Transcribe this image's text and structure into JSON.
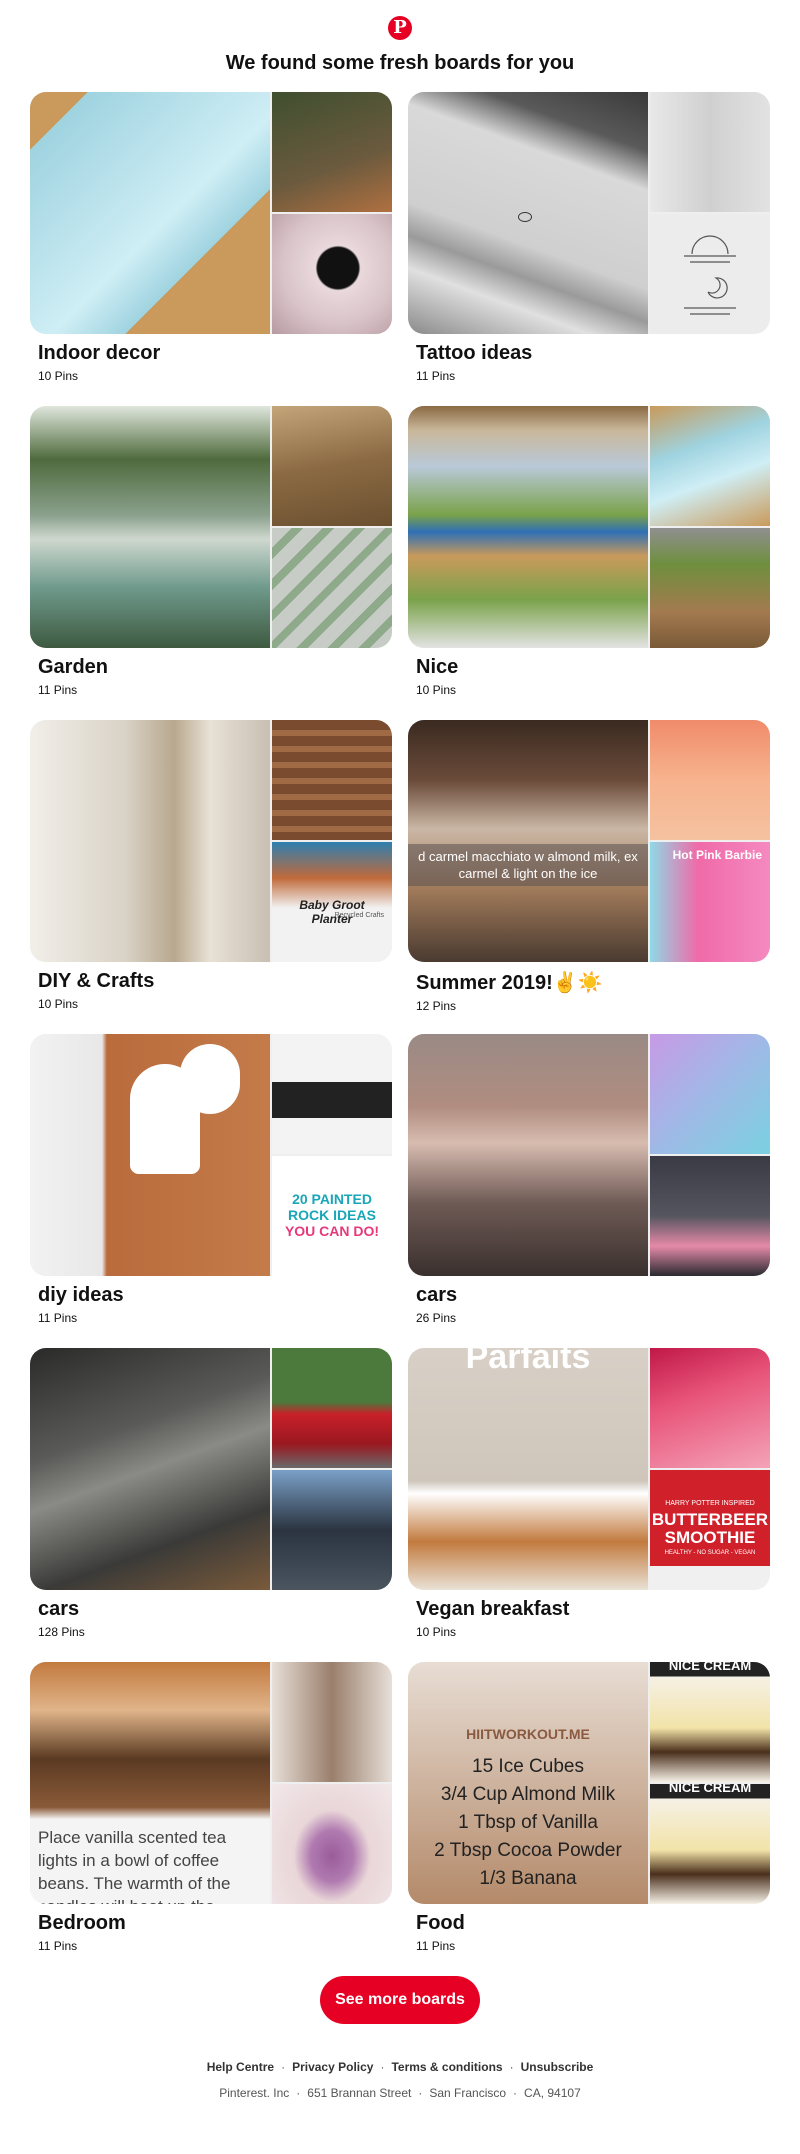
{
  "header": {
    "logo_letter": "P",
    "headline": "We found some fresh boards for you"
  },
  "boards": [
    {
      "title": "Indoor decor",
      "pins": "10 Pins",
      "tiles": {
        "main": {
          "desc": "wooden indoor plunge pool",
          "colors": [
            "#c99a5b",
            "#9fd3e0"
          ]
        },
        "top": {
          "desc": "plants on shelves",
          "colors": [
            "#6b5a3e",
            "#3f4f2f"
          ]
        },
        "bottom": {
          "desc": "white tyre planter",
          "colors": [
            "#e9d8dc",
            "#b79aa2"
          ]
        }
      }
    },
    {
      "title": "Tattoo ideas",
      "pins": "11 Pins",
      "tiles": {
        "main": {
          "desc": "small planet tattoo on shoulder",
          "colors": [
            "#d9d9d9",
            "#8a8a8a"
          ]
        },
        "top": {
          "desc": "finger tattoos",
          "colors": [
            "#e2e2e2",
            "#bdbdbd"
          ]
        },
        "bottom": {
          "desc": "sun and moon tattoo sketch",
          "colors": [
            "#ececec",
            "#cfcfcf"
          ]
        }
      }
    },
    {
      "title": "Garden",
      "pins": "11 Pins",
      "tiles": {
        "main": {
          "desc": "bathtub pond with plants",
          "colors": [
            "#8aa08c",
            "#3e5a40"
          ]
        },
        "top": {
          "desc": "wooden pallet planters",
          "colors": [
            "#8b6a43",
            "#c4a57a"
          ]
        },
        "bottom": {
          "desc": "succulents in concrete blocks",
          "colors": [
            "#c8ccc7",
            "#8fa98b"
          ]
        }
      }
    },
    {
      "title": "Nice",
      "pins": "10 Pins",
      "tiles": {
        "main": {
          "desc": "above ground pool with wooden deck",
          "colors": [
            "#7aa24a",
            "#c99a5b"
          ]
        },
        "top": {
          "desc": "wooden pool frame",
          "colors": [
            "#9fd3e0",
            "#c99a5b"
          ]
        },
        "bottom": {
          "desc": "garden steps",
          "colors": [
            "#6f8f3e",
            "#a37a4f"
          ]
        }
      }
    },
    {
      "title": "DIY & Crafts",
      "pins": "10 Pins",
      "tiles": {
        "main": {
          "desc": "rustic door shelf with flowers",
          "colors": [
            "#e8e1d6",
            "#b8a88e"
          ]
        },
        "top": {
          "desc": "pallet bench",
          "colors": [
            "#7a4b2e",
            "#a06a45"
          ]
        },
        "bottom": {
          "desc": "Baby Groot planter",
          "colors": [
            "#f2f2f2",
            "#7b6a4a"
          ]
        },
        "bottom_caption": "Baby Groot Planter",
        "bottom_subcaption": "Recycled Crafts"
      }
    },
    {
      "title": "Summer 2019!✌️☀️",
      "pins": "12 Pins",
      "tiles": {
        "main": {
          "desc": "iced caramel macchiato",
          "colors": [
            "#6b4b3a",
            "#cbb7a5"
          ]
        },
        "main_caption": "d carmel macchiato w almond milk, ex carmel & light on the ice",
        "top": {
          "desc": "peach drink recipe",
          "colors": [
            "#f7b38e",
            "#f08b6a"
          ]
        },
        "bottom": {
          "desc": "pink cocktail",
          "colors": [
            "#f06aa8",
            "#8fd9e6"
          ]
        },
        "bottom_caption": "Hot Pink Barbie"
      }
    },
    {
      "title": "diy ideas",
      "pins": "11 Pins",
      "tiles": {
        "main": {
          "desc": "paper craft tutorial",
          "colors": [
            "#b96b3c",
            "#ffffff"
          ]
        },
        "top": {
          "desc": "black card",
          "colors": [
            "#f3f3f3",
            "#222222"
          ]
        },
        "bottom": {
          "desc": "painted rocks",
          "colors": [
            "#ffffff",
            "#1aa6b7"
          ]
        },
        "bottom_caption_1": "20 PAINTED",
        "bottom_caption_2": "ROCK IDEAS",
        "bottom_caption_3": "YOU CAN DO!"
      }
    },
    {
      "title": "cars",
      "pins": "26 Pins",
      "tiles": {
        "main": {
          "desc": "rose gold Lamborghini",
          "colors": [
            "#b08d80",
            "#6e5a55"
          ]
        },
        "top": {
          "desc": "holographic Lamborghini",
          "colors": [
            "#9fb9e6",
            "#c79ae6"
          ]
        },
        "bottom": {
          "desc": "pink sports car",
          "colors": [
            "#3a3a45",
            "#e58aa8"
          ]
        }
      }
    },
    {
      "title": "cars",
      "pins": "128 Pins",
      "tiles": {
        "main": {
          "desc": "grey Lamborghini Huracan",
          "colors": [
            "#5a5a58",
            "#2a2a28"
          ]
        },
        "top": {
          "desc": "red Ferrari",
          "colors": [
            "#4b7a3c",
            "#c8202a"
          ]
        },
        "bottom": {
          "desc": "dark sports car",
          "colors": [
            "#7aa0c8",
            "#2b3440"
          ]
        }
      }
    },
    {
      "title": "Vegan breakfast",
      "pins": "10 Pins",
      "tiles": {
        "main": {
          "desc": "chia parfaits and granola",
          "colors": [
            "#d8d0c6",
            "#c27a3e"
          ]
        },
        "main_caption": "Parfaits",
        "top": {
          "desc": "pink smoothie",
          "colors": [
            "#e8547a",
            "#f4a3b8"
          ]
        },
        "bottom": {
          "desc": "butterbeer smoothie",
          "colors": [
            "#f0f0f0",
            "#d0202a"
          ]
        },
        "bottom_caption_1": "HARRY POTTER INSPIRED",
        "bottom_caption_2": "BUTTERBEER",
        "bottom_caption_3": "SMOOTHIE",
        "bottom_caption_4": "HEALTHY - NO SUGAR - VEGAN"
      }
    },
    {
      "title": "Bedroom",
      "pins": "11 Pins",
      "tiles": {
        "main": {
          "desc": "tea light in coffee beans",
          "colors": [
            "#c27a3e",
            "#5a3a22"
          ]
        },
        "main_caption": "Place vanilla scented tea lights in a bowl of coffee beans. The warmth of the candles will heat up the",
        "top": {
          "desc": "bookshelf room",
          "colors": [
            "#e7dfd8",
            "#9a7f6c"
          ]
        },
        "bottom": {
          "desc": "purple mason jar",
          "colors": [
            "#e9d6d8",
            "#9a5c9a"
          ]
        }
      }
    },
    {
      "title": "Food",
      "pins": "11 Pins",
      "tiles": {
        "main": {
          "desc": "protein shake recipe",
          "colors": [
            "#e8ddd4",
            "#b48a6a"
          ]
        },
        "main_caption_1": "HIITWORKOUT.ME",
        "main_caption_2": "15 Ice Cubes",
        "main_caption_3": "3/4 Cup  Almond Milk",
        "main_caption_4": "1 Tbsp of Vanilla",
        "main_caption_5": "2 Tbsp Cocoa Powder",
        "main_caption_6": "1/3 Banana",
        "top": {
          "desc": "banana ice cream",
          "colors": [
            "#f2e3a8",
            "#4a2f1c"
          ]
        },
        "top_caption": "NICE CREAM",
        "bottom": {
          "desc": "banana ice cream bowls",
          "colors": [
            "#f2e3a8",
            "#4a2f1c"
          ]
        },
        "bottom_caption": "NICE CREAM"
      }
    }
  ],
  "cta": {
    "label": "See more boards",
    "color": "#e60023"
  },
  "footer": {
    "links": [
      "Help Centre",
      "Privacy Policy",
      "Terms & conditions",
      "Unsubscribe"
    ],
    "address": [
      "Pinterest. Inc",
      "651 Brannan Street",
      "San Francisco",
      "CA, 94107"
    ]
  }
}
